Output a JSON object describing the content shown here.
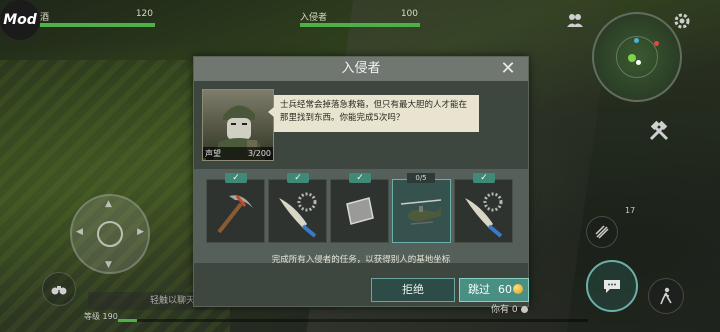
{
  "hud": {
    "mod_badge": "Mod",
    "left_stat": {
      "label": "酒",
      "value": "120"
    },
    "right_stat": {
      "label": "入侵者",
      "value": "100"
    },
    "level_label": "等级 190",
    "chat_placeholder": "轻触以聊天",
    "badge_number": "17",
    "have_label": "你有",
    "have_value": "0"
  },
  "dialog": {
    "title": "入侵者",
    "close_icon": "close-icon",
    "portrait": {
      "caption_left": "声望",
      "caption_right": "3/200"
    },
    "speech": "士兵经常会掉落急救箱，但只有最大胆的人才能在那里找到东西。你能完成5次吗？",
    "tasks": [
      {
        "item": "pickaxe-icon",
        "status": "done",
        "badge": "✓"
      },
      {
        "item": "saw-blade-machete-icon",
        "status": "done",
        "badge": "✓"
      },
      {
        "item": "metal-plate-icon",
        "status": "done",
        "badge": "✓"
      },
      {
        "item": "helicopter-icon",
        "status": "in-progress",
        "badge": "0/5"
      },
      {
        "item": "saw-blade-machete-icon",
        "status": "done",
        "badge": "✓"
      }
    ],
    "footer": "完成所有入侵者的任务，以获得别人的基地坐标",
    "refuse_label": "拒绝",
    "skip_label": "跳过",
    "skip_cost": "60"
  },
  "colors": {
    "accent": "#4a8f84",
    "hp_green": "#4fb04a",
    "panel": "#3e4640"
  }
}
